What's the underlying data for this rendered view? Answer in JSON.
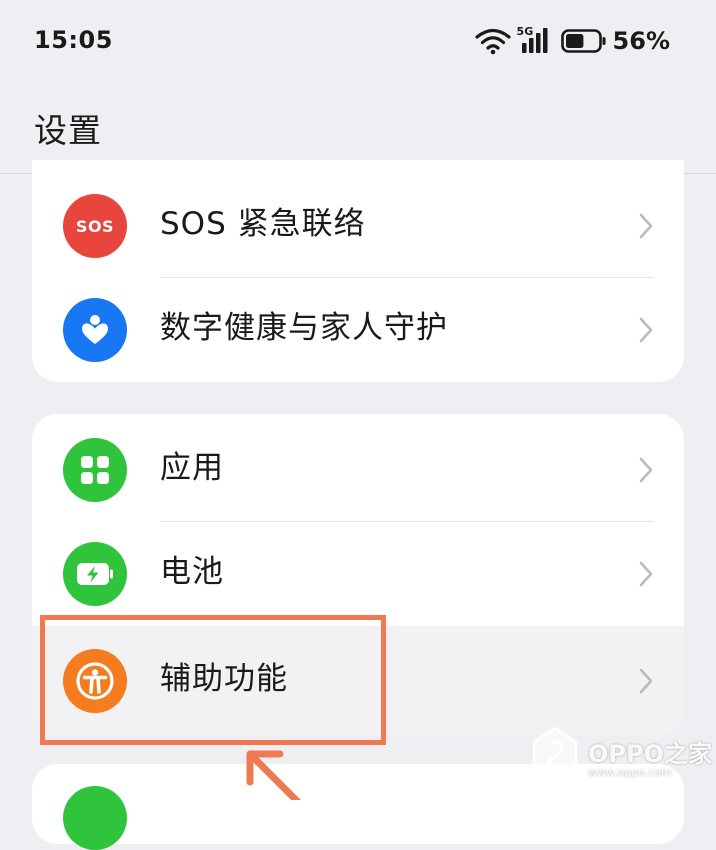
{
  "status_bar": {
    "time": "15:05",
    "network_label": "5G",
    "battery_percent": "56%",
    "battery_level": 0.56
  },
  "page": {
    "title": "设置"
  },
  "groups": [
    {
      "items": [
        {
          "label": "SOS 紧急联络",
          "icon": "sos-icon",
          "icon_text": "SOS",
          "color": "#e8453c"
        },
        {
          "label": "数字健康与家人守护",
          "icon": "heart-person-icon",
          "color": "#1877f2"
        }
      ]
    },
    {
      "items": [
        {
          "label": "应用",
          "icon": "apps-grid-icon",
          "color": "#2fc43c"
        },
        {
          "label": "电池",
          "icon": "battery-charging-icon",
          "color": "#2fc43c"
        },
        {
          "label": "辅助功能",
          "icon": "accessibility-icon",
          "color": "#f57c1f"
        }
      ]
    }
  ],
  "annotation": {
    "color": "#f07a4f"
  },
  "watermark": {
    "text": "OPPO之家",
    "url": "www.oppo.com"
  }
}
